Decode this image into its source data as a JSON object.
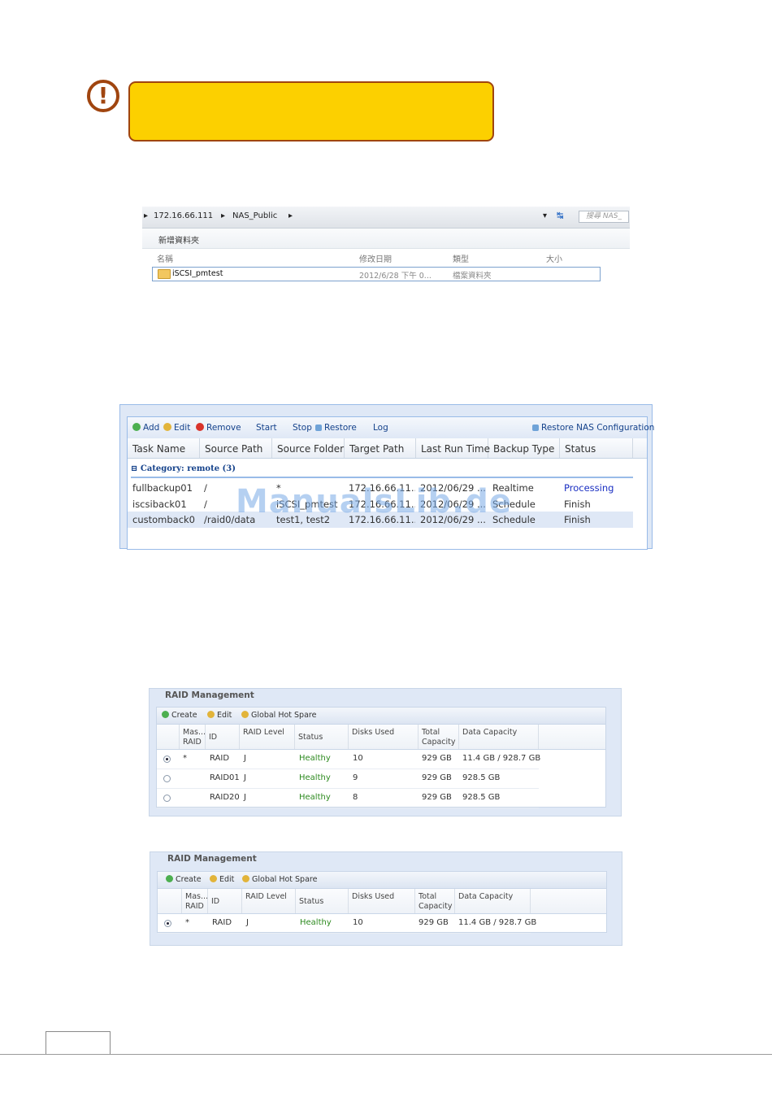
{
  "warning": {
    "icon_glyph": "!"
  },
  "explorer": {
    "breadcrumb": [
      "172.16.66.111",
      "NAS_Public"
    ],
    "search_placeholder": "搜尋 NAS_",
    "new_folder_label": "新增資料夾",
    "columns": [
      "名稱",
      "修改日期",
      "類型",
      "大小"
    ],
    "rows": [
      {
        "name": "iSCSI_pmtest",
        "modified": "2012/6/28 下午 0...",
        "type": "檔案資料夾",
        "size": ""
      }
    ]
  },
  "backup": {
    "toolbar": {
      "add": "Add",
      "edit": "Edit",
      "remove": "Remove",
      "start": "Start",
      "stop": "Stop",
      "restore": "Restore",
      "log": "Log",
      "restore_nas": "Restore NAS Configuration"
    },
    "columns": [
      "Task Name",
      "Source Path",
      "Source Folder",
      "Target Path",
      "Last Run Time",
      "Backup Type",
      "Status"
    ],
    "category": "Category: remote (3)",
    "rows": [
      {
        "task": "fullbackup01",
        "source_path": "/",
        "source_folder": "*",
        "target": "172.16.66.11...",
        "last_run": "2012/06/29 ...",
        "type": "Realtime",
        "status": "Processing"
      },
      {
        "task": "iscsiback01",
        "source_path": "/",
        "source_folder": "iSCSI_pmtest",
        "target": "172.16.66.11...",
        "last_run": "2012/06/29 ...",
        "type": "Schedule",
        "status": "Finish"
      },
      {
        "task": "customback0",
        "source_path": "/raid0/data",
        "source_folder": "test1, test2",
        "target": "172.16.66.11...",
        "last_run": "2012/06/29 ...",
        "type": "Schedule",
        "status": "Finish"
      }
    ],
    "watermark": "ManualsLib.de"
  },
  "raid1": {
    "title": "RAID Management",
    "toolbar": {
      "create": "Create",
      "edit": "Edit",
      "hot_spare": "Global Hot Spare"
    },
    "columns": [
      "Mas... RAID",
      "ID",
      "RAID Level",
      "Status",
      "Disks Used",
      "Total Capacity",
      "Data Capacity"
    ],
    "rows": [
      {
        "selected": true,
        "master": "*",
        "id": "RAID",
        "level": "J",
        "status": "Healthy",
        "disks": "10",
        "total": "929 GB",
        "data": "11.4 GB / 928.7 GB"
      },
      {
        "selected": false,
        "master": "",
        "id": "RAID01",
        "level": "J",
        "status": "Healthy",
        "disks": "9",
        "total": "929 GB",
        "data": "928.5 GB"
      },
      {
        "selected": false,
        "master": "",
        "id": "RAID20",
        "level": "J",
        "status": "Healthy",
        "disks": "8",
        "total": "929 GB",
        "data": "928.5 GB"
      }
    ]
  },
  "raid2": {
    "title": "RAID Management",
    "toolbar": {
      "create": "Create",
      "edit": "Edit",
      "hot_spare": "Global Hot Spare"
    },
    "columns": [
      "Mas... RAID",
      "ID",
      "RAID Level",
      "Status",
      "Disks Used",
      "Total Capacity",
      "Data Capacity"
    ],
    "rows": [
      {
        "selected": true,
        "master": "*",
        "id": "RAID",
        "level": "J",
        "status": "Healthy",
        "disks": "10",
        "total": "929 GB",
        "data": "11.4 GB / 928.7 GB"
      }
    ]
  },
  "colors": {
    "accent": "#fcd000",
    "border_warn": "#a0450f",
    "healthy": "#2d8a1f",
    "link": "#15428b",
    "processing": "#1a2fc2"
  }
}
